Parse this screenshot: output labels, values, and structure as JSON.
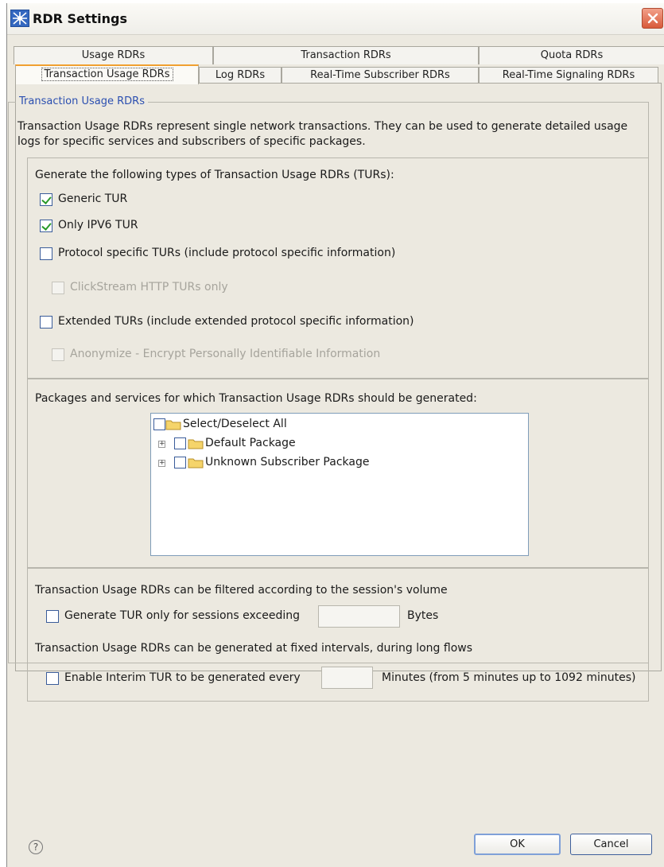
{
  "window": {
    "title": "RDR Settings"
  },
  "tabs": {
    "row1": [
      "Usage RDRs",
      "Transaction RDRs",
      "Quota RDRs"
    ],
    "row2": [
      "Transaction Usage RDRs",
      "Log RDRs",
      "Real-Time Subscriber RDRs",
      "Real-Time Signaling RDRs"
    ],
    "active": "Transaction Usage RDRs"
  },
  "group": {
    "legend": "Transaction Usage RDRs",
    "description": "Transaction Usage RDRs represent single network transactions. They can be used to generate detailed usage logs for specific services and subscribers of specific packages."
  },
  "types": {
    "heading": "Generate the following types of Transaction Usage RDRs (TURs):",
    "options": [
      {
        "label": "Generic TUR",
        "checked": true,
        "enabled": true
      },
      {
        "label": "Only IPV6 TUR",
        "checked": true,
        "enabled": true
      },
      {
        "label": "Protocol specific TURs (include protocol specific information)",
        "checked": false,
        "enabled": true
      },
      {
        "label": "ClickStream HTTP TURs only",
        "checked": false,
        "enabled": false
      },
      {
        "label": "Extended TURs (include extended protocol specific information)",
        "checked": false,
        "enabled": true
      },
      {
        "label": "Anonymize - Encrypt Personally Identifiable Information",
        "checked": false,
        "enabled": false
      }
    ]
  },
  "packages": {
    "heading": "Packages and services for which Transaction Usage RDRs should be generated:",
    "tree": [
      {
        "label": "Select/Deselect All",
        "checked": false,
        "expandable": false
      },
      {
        "label": "Default Package",
        "checked": false,
        "expandable": true
      },
      {
        "label": "Unknown Subscriber Package",
        "checked": false,
        "expandable": true
      }
    ]
  },
  "filters": {
    "volume_heading": "Transaction Usage RDRs can be filtered according to the session's volume",
    "volume_option": {
      "label": "Generate TUR only for sessions exceeding",
      "checked": false,
      "value": "",
      "unit": "Bytes"
    },
    "interval_heading": "Transaction Usage RDRs can be generated at fixed intervals, during long flows",
    "interval_option": {
      "label": "Enable Interim TUR to be generated every",
      "checked": false,
      "value": "",
      "unit": "Minutes (from 5 minutes up to 1092 minutes)"
    }
  },
  "footer": {
    "help_glyph": "?",
    "ok_label": "OK",
    "cancel_label": "Cancel"
  },
  "colors": {
    "window_bg": "#ece9e0",
    "legend_text": "#2b4fb0",
    "active_tab_accent": "#f0a030",
    "check_mark": "#2a9a2a"
  }
}
